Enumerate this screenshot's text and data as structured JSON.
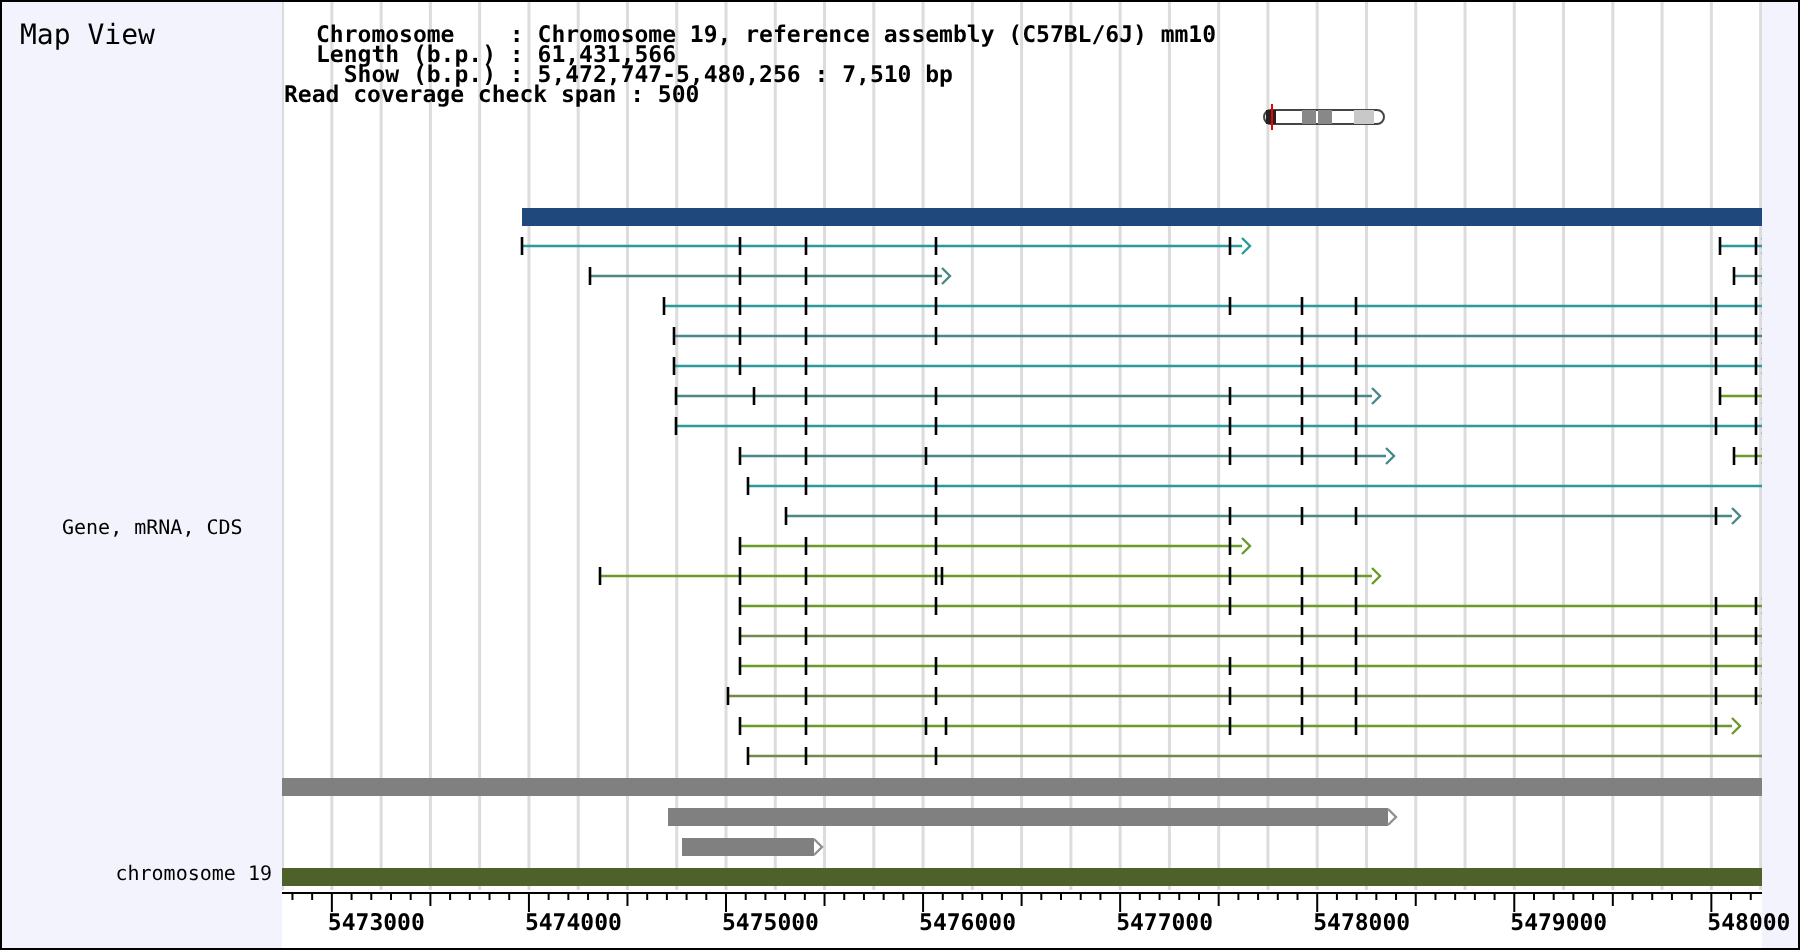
{
  "title": "Map View",
  "info": {
    "lines": [
      {
        "kind": "main",
        "text": "Chromosome    : Chromosome 19, reference assembly (C57BL/6J) mm10"
      },
      {
        "kind": "main",
        "text": "Length (b.p.) : 61,431,566"
      },
      {
        "kind": "main",
        "text": "  Show (b.p.) : 5,472,747-5,480,256 : 7,510 bp"
      },
      {
        "kind": "outdent",
        "text": "Read coverage check span : 500"
      }
    ]
  },
  "track_label": "Gene, mRNA, CDS",
  "chromosome_label": "chromosome 19",
  "axis": {
    "labels": [
      "5473000",
      "5474000",
      "5475000",
      "5476000",
      "5477000",
      "5478000",
      "5479000",
      "548000"
    ]
  }
}
